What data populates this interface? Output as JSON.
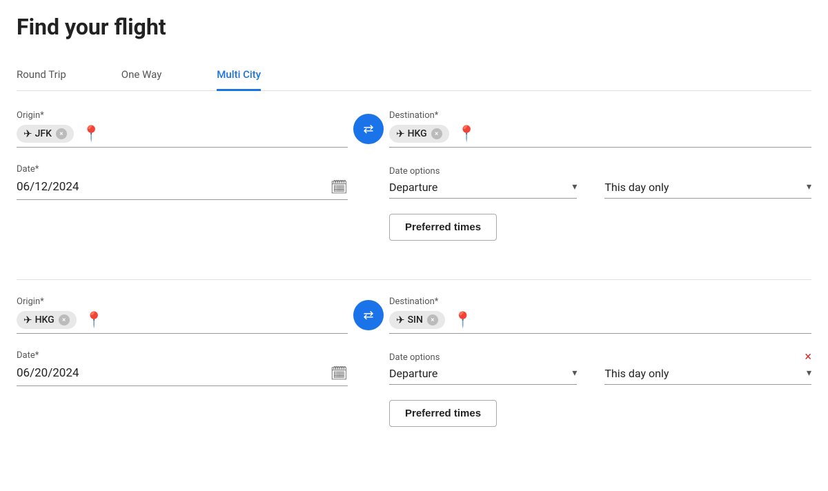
{
  "page": {
    "title": "Find your flight"
  },
  "tabs": [
    {
      "id": "round-trip",
      "label": "Round Trip",
      "active": false
    },
    {
      "id": "one-way",
      "label": "One Way",
      "active": false
    },
    {
      "id": "multi-city",
      "label": "Multi City",
      "active": true
    }
  ],
  "segments": [
    {
      "id": "seg1",
      "origin": {
        "label": "Origin*",
        "code": "JFK"
      },
      "destination": {
        "label": "Destination*",
        "code": "HKG"
      },
      "date": {
        "label": "Date*",
        "value": "06/12/2024"
      },
      "dateOptions": {
        "label": "Date options",
        "value": "Departure"
      },
      "dayFilter": {
        "value": "This day only"
      },
      "preferredTimesBtn": "Preferred times",
      "removable": false
    },
    {
      "id": "seg2",
      "origin": {
        "label": "Origin*",
        "code": "HKG"
      },
      "destination": {
        "label": "Destination*",
        "code": "SIN"
      },
      "date": {
        "label": "Date*",
        "value": "06/20/2024"
      },
      "dateOptions": {
        "label": "Date options",
        "value": "Departure"
      },
      "dayFilter": {
        "value": "This day only"
      },
      "preferredTimesBtn": "Preferred times",
      "removable": true
    }
  ],
  "icons": {
    "plane": "✈",
    "location_pin": "📍",
    "swap": "⇄",
    "calendar": "📅",
    "chevron": "▾",
    "close": "×",
    "remove": "×"
  }
}
